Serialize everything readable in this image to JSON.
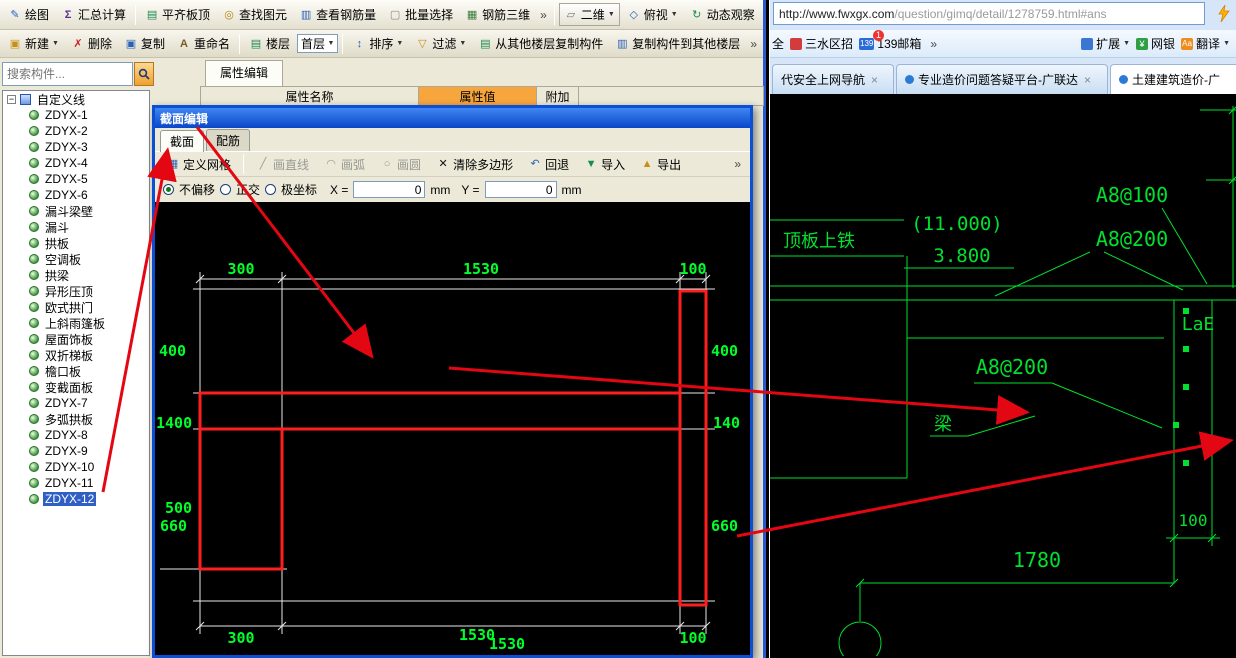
{
  "ui": {
    "caret": "▼",
    "close": "×",
    "overflow": "»",
    "minus": "−"
  },
  "app": {
    "menubar": {
      "items": [
        {
          "glyph": "✎",
          "label": "绘图"
        },
        {
          "glyph": "Σ",
          "label": "汇总计算"
        },
        {
          "glyph": "▤",
          "label": "平齐板顶"
        },
        {
          "glyph": "◎",
          "label": "查找图元"
        },
        {
          "glyph": "▥",
          "label": "查看钢筋量"
        },
        {
          "glyph": "▢",
          "label": "批量选择"
        },
        {
          "glyph": "▦",
          "label": "钢筋三维"
        },
        {
          "glyph": "▱",
          "label": "二维"
        },
        {
          "glyph": "◇",
          "label": "俯视"
        },
        {
          "glyph": "↻",
          "label": "动态观察"
        }
      ]
    },
    "toolbar": {
      "new": "新建",
      "delete": "删除",
      "copy": "复制",
      "rename": "重命名",
      "floor": "楼层",
      "floor_value": "首层",
      "sort": "排序",
      "filter": "过滤",
      "copy_from": "从其他楼层复制构件",
      "copy_to": "复制构件到其他楼层"
    },
    "search": {
      "placeholder": "搜索构件..."
    },
    "tree": {
      "root": "自定义线",
      "items": [
        "ZDYX-1",
        "ZDYX-2",
        "ZDYX-3",
        "ZDYX-4",
        "ZDYX-5",
        "ZDYX-6",
        "漏斗梁壁",
        "漏斗",
        "拱板",
        "空调板",
        "拱梁",
        "异形压顶",
        "欧式拱门",
        "上斜雨篷板",
        "屋面饰板",
        "双折梯板",
        "檐口板",
        "变截面板",
        "ZDYX-7",
        "多弧拱板",
        "ZDYX-8",
        "ZDYX-9",
        "ZDYX-10",
        "ZDYX-11",
        "ZDYX-12"
      ]
    },
    "props": {
      "tab": "属性编辑",
      "col_name": "属性名称",
      "col_value": "属性值",
      "col_extra": "附加"
    },
    "dialog": {
      "title": "截面编辑",
      "tab_section": "截面",
      "tab_rebar": "配筋",
      "tools": {
        "grid": "定义网格",
        "line": "画直线",
        "arc": "画弧",
        "circle": "画圆",
        "clear": "清除多边形",
        "undo": "回退",
        "import": "导入",
        "export": "导出"
      },
      "modes": {
        "no_offset": "不偏移",
        "ortho": "正交",
        "polar": "极坐标"
      },
      "coord": {
        "x_label": "X =",
        "x_value": "0",
        "x_unit": "mm",
        "y_label": "Y =",
        "y_value": "0",
        "y_unit": "mm"
      }
    }
  },
  "section": {
    "dims": {
      "top": [
        "300",
        "1530",
        "100"
      ],
      "bottom": [
        "300",
        "1530",
        "100"
      ],
      "bottom_dup": "1530",
      "left": [
        "400",
        "1400",
        "500",
        "660"
      ],
      "right": [
        "400",
        "140",
        "660"
      ]
    }
  },
  "browser": {
    "url_host": "http://www.fwxgx.com",
    "url_path": "/question/gimq/detail/1278759.html#ans",
    "bookmarks": {
      "clipped": "全",
      "item1": "三水区招",
      "mail_icon": "139",
      "item2": "139邮箱",
      "badge": "1",
      "ext": "扩展",
      "bank": "网银",
      "bank_glyph": "¥",
      "trans_icon": "Aa",
      "translate": "翻译"
    },
    "tabs": [
      {
        "title": "代安全上网导航"
      },
      {
        "title": "专业造价问题答疑平台-广联达"
      },
      {
        "title": "土建建筑造价-广"
      }
    ],
    "cad": {
      "top_steel": "顶板上铁",
      "elev1": "(11.000)",
      "elev2": "3.800",
      "rebar_top1": "A8@100",
      "rebar_top2": "A8@200",
      "lae": "LaE",
      "rebar_mid": "A8@200",
      "beam": "梁",
      "dim_small": "100",
      "dim_big": "1780"
    }
  }
}
